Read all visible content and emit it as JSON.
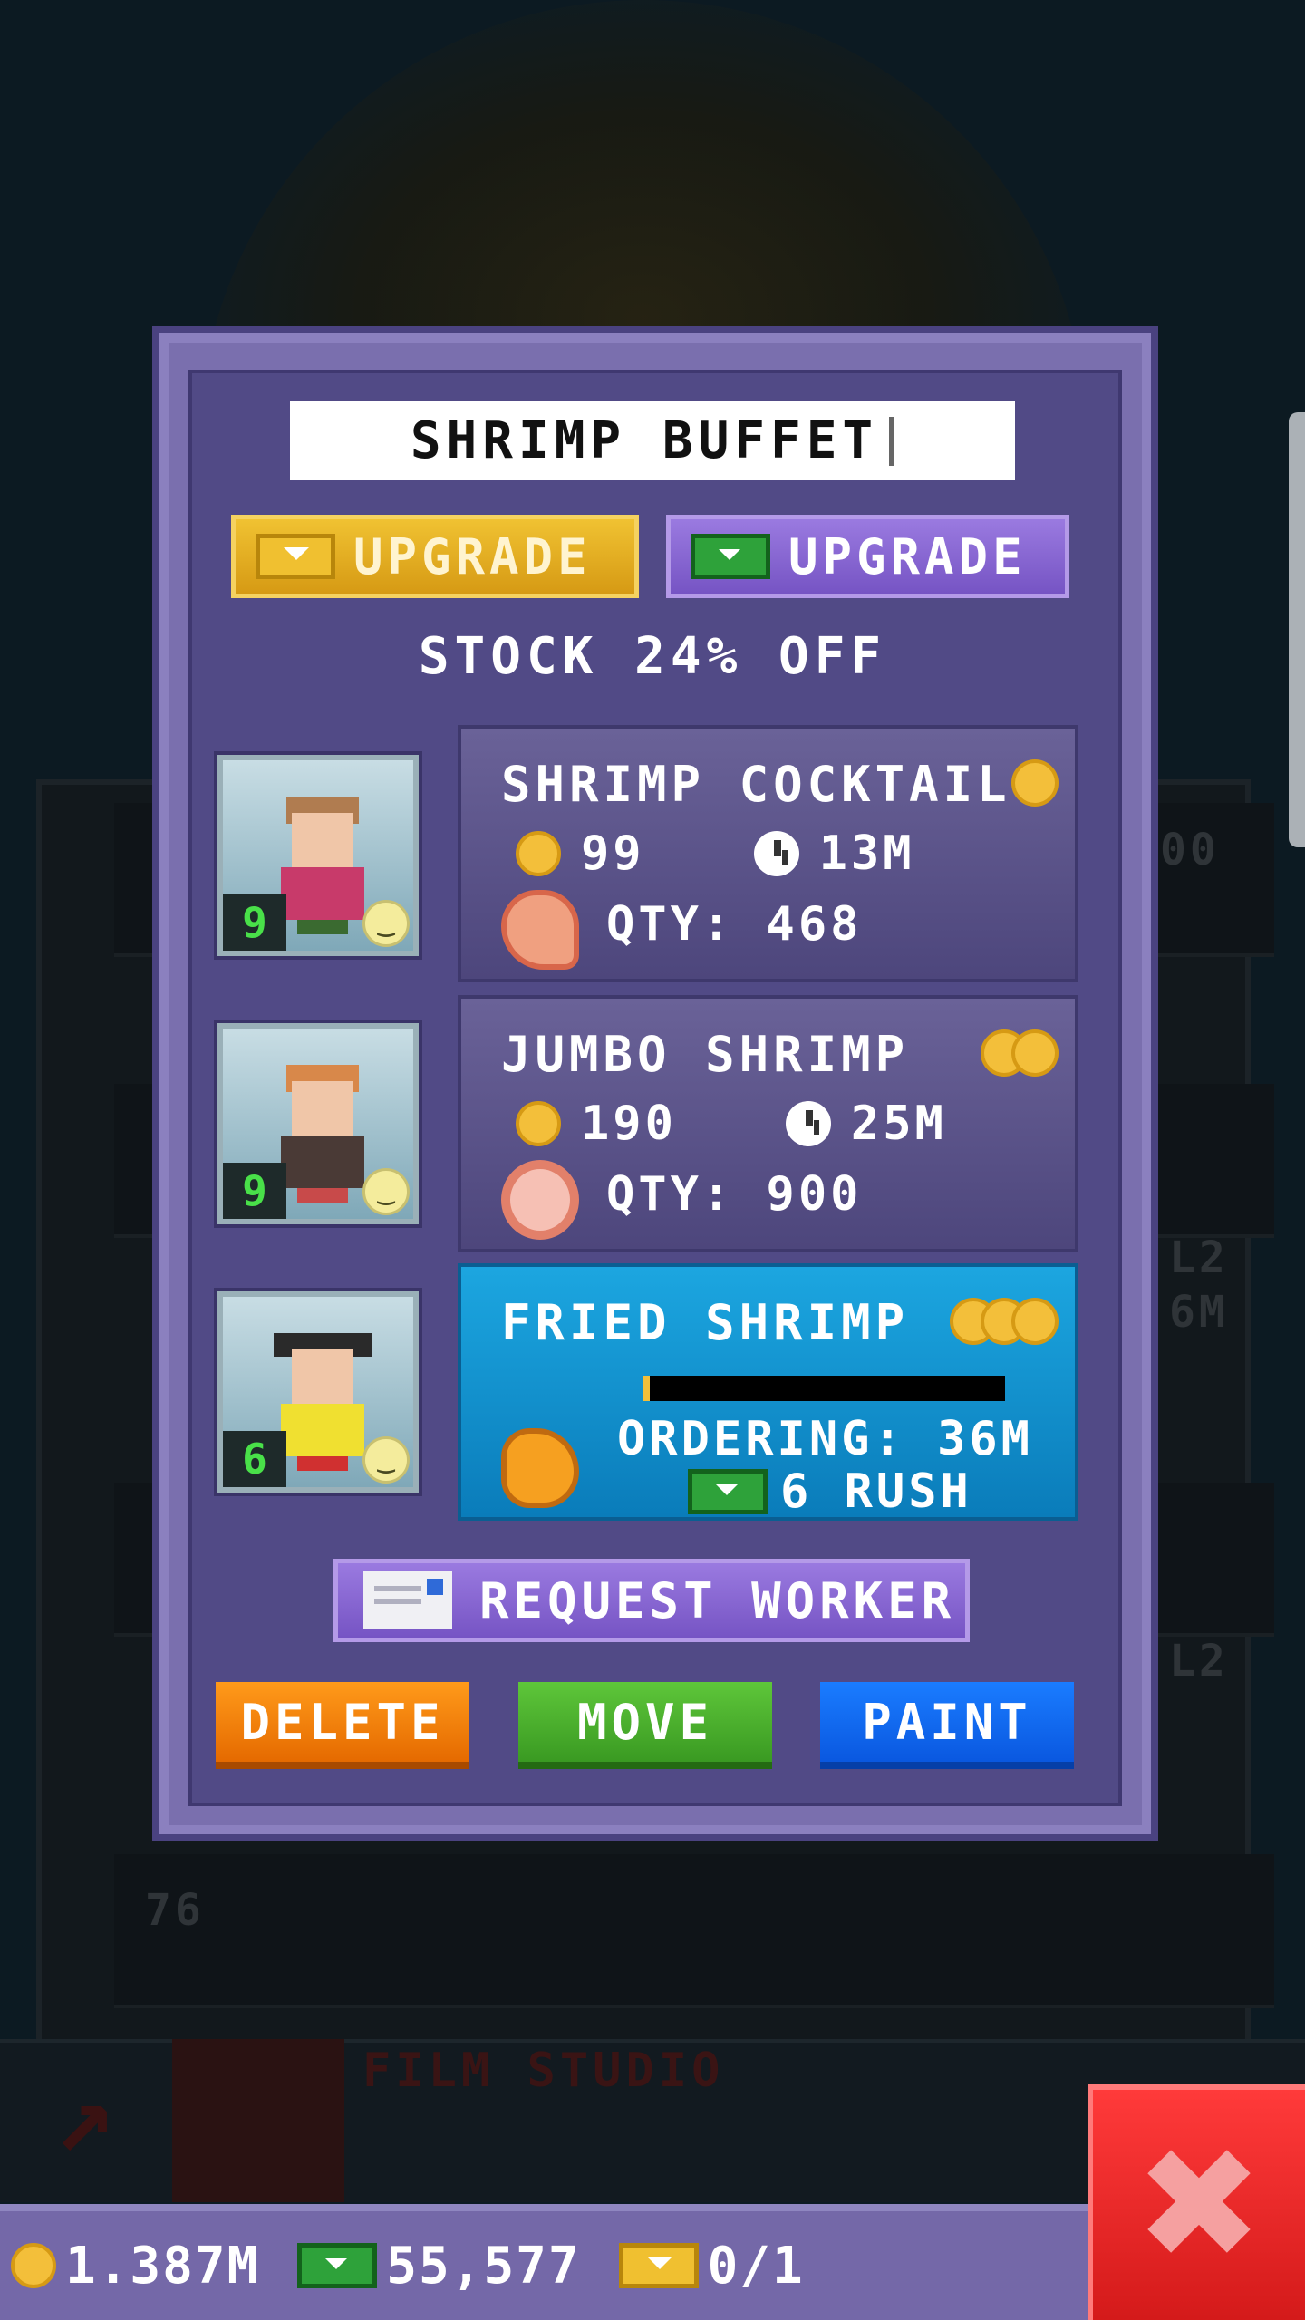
{
  "dialog": {
    "title": "SHRIMP BUFFET",
    "upgrade_gold_label": "UPGRADE",
    "upgrade_bux_label": "UPGRADE",
    "stock_text": "STOCK 24% OFF"
  },
  "products": [
    {
      "name": "SHRIMP COCKTAIL",
      "cost": "99",
      "time": "13M",
      "qty": "QTY: 468",
      "worker_level": "9",
      "coin_tier": 1
    },
    {
      "name": "JUMBO SHRIMP",
      "cost": "190",
      "time": "25M",
      "qty": "QTY: 900",
      "worker_level": "9",
      "coin_tier": 2
    },
    {
      "name": "FRIED SHRIMP",
      "ordering": "ORDERING: 36M",
      "rush": "6 RUSH",
      "worker_level": "6",
      "coin_tier": 3,
      "progress": 0.02
    }
  ],
  "actions": {
    "request_worker": "REQUEST WORKER",
    "delete": "DELETE",
    "move": "MOVE",
    "paint": "PAINT"
  },
  "status": {
    "coins": "1.387M",
    "bux": "55,577",
    "tickets": "0/1"
  },
  "background": {
    "film_label": "FILM STUDIO",
    "floor_numbers": [
      "00",
      "L2",
      "6M",
      "L2",
      "76",
      "L2"
    ]
  },
  "colors": {
    "dialog": "#7a6fae",
    "gold": "#f3bf3a",
    "active_card": "#1ca6e0",
    "delete": "#e56a00",
    "move": "#3a9a22",
    "paint": "#0a58e0",
    "close": "#d41a1a"
  }
}
